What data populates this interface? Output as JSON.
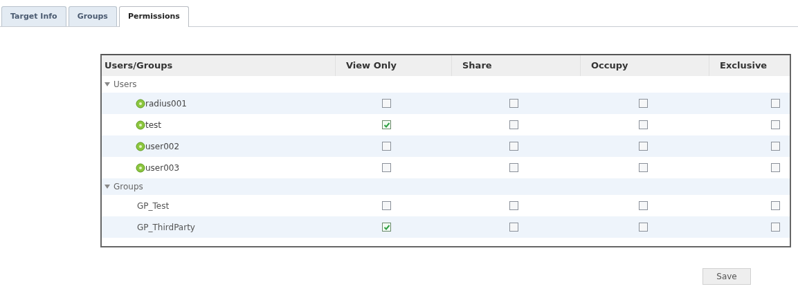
{
  "tabs": [
    {
      "label": "Target Info",
      "selected": false
    },
    {
      "label": "Groups",
      "selected": false
    },
    {
      "label": "Permissions",
      "selected": true
    }
  ],
  "table": {
    "columns": [
      "Users/Groups",
      "View Only",
      "Share",
      "Occupy",
      "Exclusive"
    ],
    "sections": [
      {
        "label": "Users",
        "expanded": true,
        "rows": [
          {
            "name": "radius001",
            "kind": "user",
            "checks": [
              false,
              false,
              false,
              false
            ]
          },
          {
            "name": "test",
            "kind": "user",
            "checks": [
              true,
              false,
              false,
              false
            ]
          },
          {
            "name": "user002",
            "kind": "user",
            "checks": [
              false,
              false,
              false,
              false
            ]
          },
          {
            "name": "user003",
            "kind": "user",
            "checks": [
              false,
              false,
              false,
              false
            ]
          }
        ]
      },
      {
        "label": "Groups",
        "expanded": true,
        "rows": [
          {
            "name": "GP_Test",
            "kind": "group",
            "checks": [
              false,
              false,
              false,
              false
            ]
          },
          {
            "name": "GP_ThirdParty",
            "kind": "group",
            "checks": [
              true,
              false,
              false,
              false
            ]
          }
        ]
      }
    ]
  },
  "save_button": "Save"
}
